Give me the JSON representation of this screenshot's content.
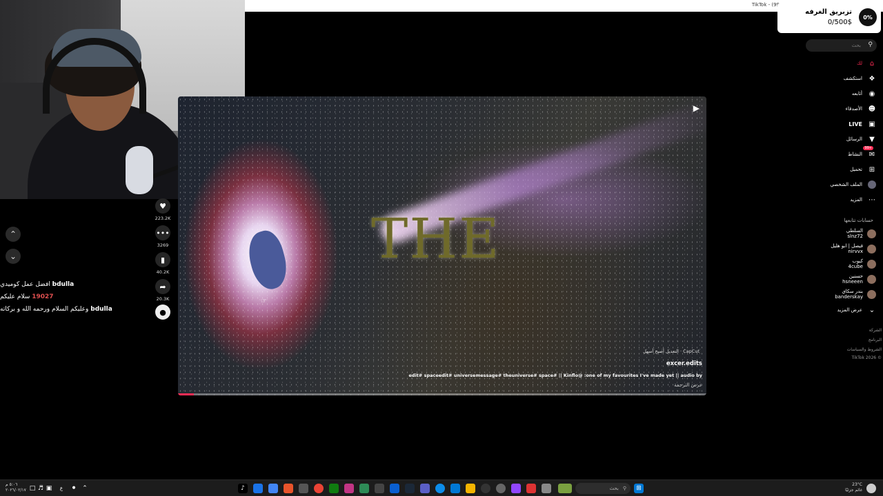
{
  "browser": {
    "tab_title": "TikTok - (99"
  },
  "stream_chat": {
    "messages": [
      {
        "user": "bdulla",
        "text": "افضل عمل كوميدي",
        "user_color": "#ffffff"
      },
      {
        "user": "19027",
        "text": "سلام عليكم",
        "user_color": "#e05050"
      },
      {
        "user": "bdulla",
        "text": "وعليكم السلام ورحمه الله و بركاته",
        "user_color": "#ffffff"
      }
    ]
  },
  "actions": {
    "likes": "223.2K",
    "comments": "3269",
    "saves": "40.2K",
    "shares": "20.3K"
  },
  "video": {
    "overlay_title": "THE",
    "capcut_text": "CapCut · التعديل أصبح أسهل",
    "author": "excer.edits",
    "caption": "edit# spaceedit# universemessage# theuniverse# space# || Kinflo@ :one of my favourites I've made yet || audio by",
    "see_translation": "عرض الترجمة",
    "progress": 0.03
  },
  "goal": {
    "title": "تزبريق الغرفه",
    "value": "0/500$",
    "percent": "0%"
  },
  "search": {
    "placeholder": "بحث"
  },
  "nav": {
    "foryou": "لك",
    "explore": "استكشف",
    "following": "أتابعه",
    "friends": "الأصدقاء",
    "live": "LIVE",
    "messages": "الرسائل",
    "activity": "النشاط",
    "activity_badge": "99+",
    "upload": "تحميل",
    "profile": "الملف الشخصي",
    "more": "المزيد"
  },
  "following_section": {
    "title": "حسابات تتابعها",
    "accounts": [
      {
        "name": "السلطي",
        "handle": "slnz72"
      },
      {
        "name": "فيصل | ابو هليل",
        "handle": "nirvvx"
      },
      {
        "name": "كيوب",
        "handle": "4cube"
      },
      {
        "name": "حسنين",
        "handle": "hsneeen"
      },
      {
        "name": "بندر سكاي",
        "handle": "banderskay"
      }
    ],
    "see_more": "عرض المزيد"
  },
  "footer": {
    "company": "الشركة",
    "program": "البرنامج",
    "terms": "الشروط والسياسات",
    "copyright": "TikTok 2026 ©"
  },
  "taskbar": {
    "search_placeholder": "بحث",
    "clock_time": "٥:٠٦ م",
    "clock_date": "٢٠٢٦/٠٢/١٧",
    "temperature": "23°C",
    "weather": "غائم جزئيًا",
    "lang": "ع"
  }
}
